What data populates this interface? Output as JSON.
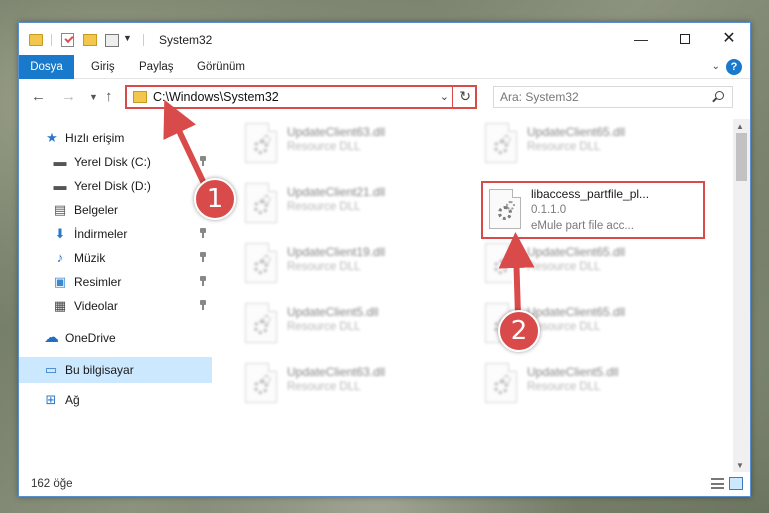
{
  "titlebar": {
    "title": "System32",
    "minimize": "—",
    "close": "✕"
  },
  "ribbon": {
    "tabs": [
      "Dosya",
      "Giriş",
      "Paylaş",
      "Görünüm"
    ],
    "help": "?"
  },
  "navbar": {
    "address": "C:\\Windows\\System32",
    "search_placeholder": "Ara: System32"
  },
  "sidebar": {
    "items": [
      {
        "label": "Hızlı erişim",
        "icon": "star-icon"
      },
      {
        "label": "Yerel Disk (C:)",
        "icon": "drive-icon",
        "pinned": true
      },
      {
        "label": "Yerel Disk (D:)",
        "icon": "drive-icon",
        "pinned": true
      },
      {
        "label": "Belgeler",
        "icon": "documents-icon",
        "pinned": true
      },
      {
        "label": "İndirmeler",
        "icon": "download-icon",
        "pinned": true
      },
      {
        "label": "Müzik",
        "icon": "music-icon",
        "pinned": true
      },
      {
        "label": "Resimler",
        "icon": "pictures-icon",
        "pinned": true
      },
      {
        "label": "Videolar",
        "icon": "videos-icon",
        "pinned": true
      },
      {
        "label": "OneDrive",
        "icon": "cloud-icon"
      },
      {
        "label": "Bu bilgisayar",
        "icon": "computer-icon",
        "selected": true
      },
      {
        "label": "Ağ",
        "icon": "network-icon"
      }
    ]
  },
  "files": [
    {
      "name": "UpdateClient63.dll",
      "type": "Resource DLL"
    },
    {
      "name": "UpdateClient65.dll",
      "type": "Resource DLL"
    },
    {
      "name": "UpdateClient21.dll",
      "type": "Resource DLL"
    },
    {
      "name": "libaccess_partfile_pl...",
      "version": "0.1.1.0",
      "description": "eMule part file acc...",
      "highlighted": true
    },
    {
      "name": "UpdateClient19.dll",
      "type": "Resource DLL"
    },
    {
      "name": "UpdateClient65.dll",
      "type": "Resource DLL"
    },
    {
      "name": "UpdateClient5.dll",
      "type": "Resource DLL"
    },
    {
      "name": "UpdateClient65.dll",
      "type": "Resource DLL"
    },
    {
      "name": "UpdateClient63.dll",
      "type": "Resource DLL"
    },
    {
      "name": "UpdateClient5.dll",
      "type": "Resource DLL"
    }
  ],
  "status": {
    "count": "162 öğe"
  },
  "annotations": {
    "badge1": "1",
    "badge2": "2"
  },
  "colors": {
    "accent": "#1979ca",
    "highlight": "#d94b4b",
    "selected": "#cce8ff"
  }
}
